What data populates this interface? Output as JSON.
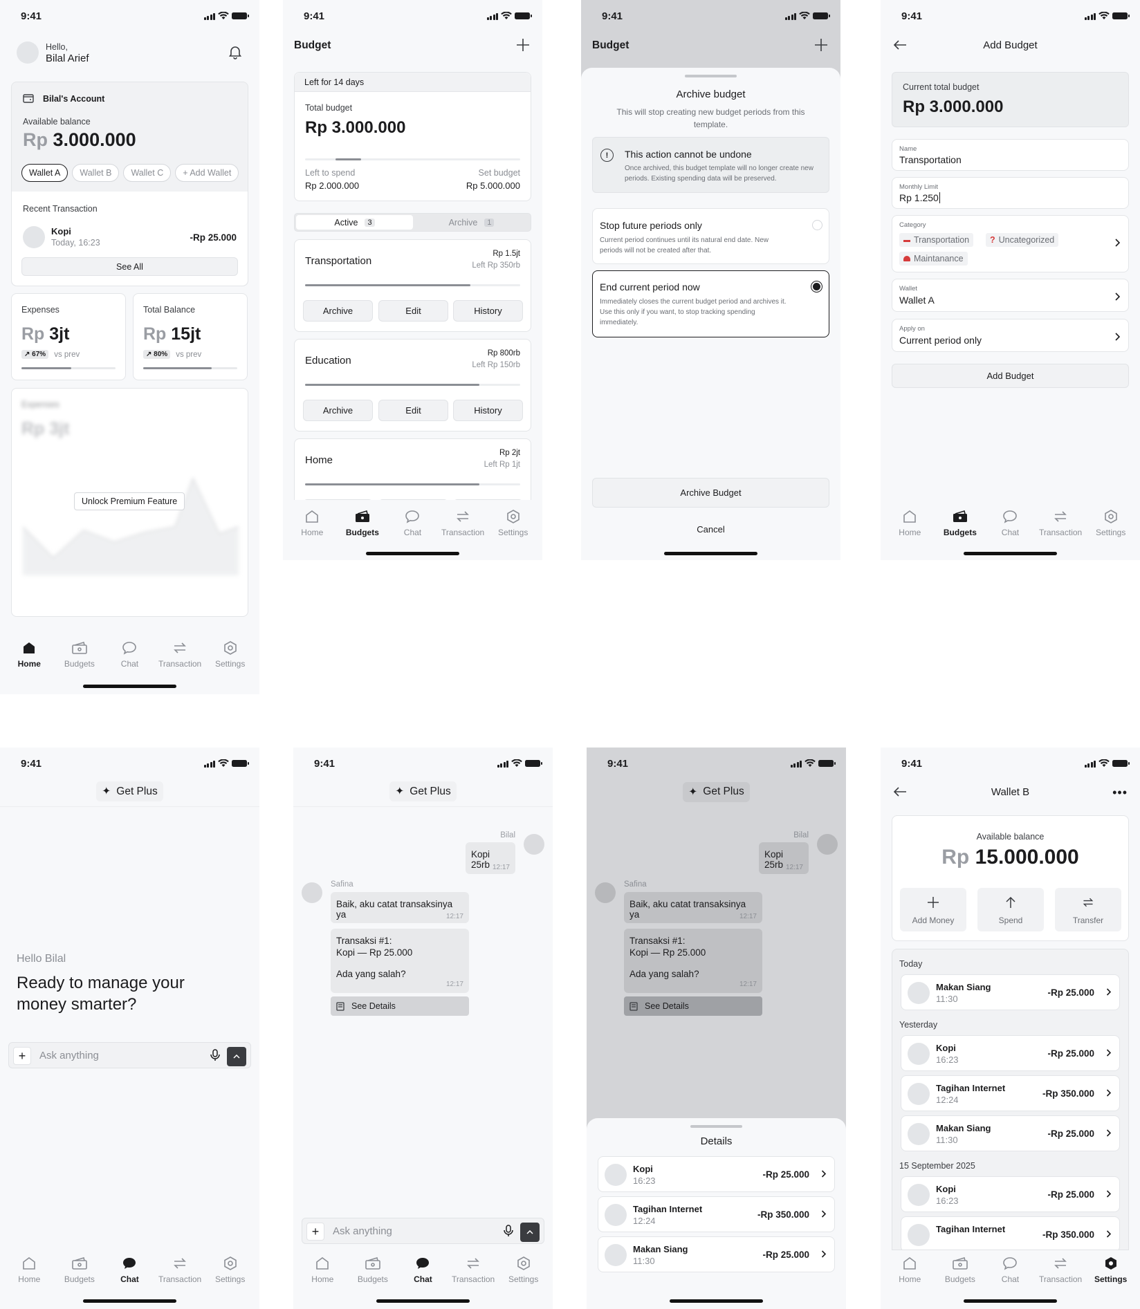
{
  "status_time": "9:41",
  "nav": {
    "home": "Home",
    "budgets": "Budgets",
    "chat": "Chat",
    "transaction": "Transaction",
    "settings": "Settings"
  },
  "home": {
    "greeting": "Hello,",
    "user": "Bilal Arief",
    "account_name": "Bilal's Account",
    "balance_label": "Available balance",
    "balance_prefix": "Rp",
    "balance": "3.000.000",
    "wallets": [
      "Wallet A",
      "Wallet B",
      "Wallet C",
      "+ Add Wallet"
    ],
    "recent_label": "Recent Transaction",
    "recent_name": "Kopi",
    "recent_time": "Today, 16:23",
    "recent_amount": "-Rp 25.000",
    "see_all": "See All",
    "expenses_label": "Expenses",
    "expenses_prefix": "Rp",
    "expenses_value": "3jt",
    "expenses_pct": "67%",
    "vs_prev": "vs prev",
    "total_label": "Total Balance",
    "total_prefix": "Rp",
    "total_value": "15jt",
    "total_pct": "80%",
    "chart_title": "Expenses",
    "chart_prefix": "Rp",
    "chart_value": "3jt",
    "unlock": "Unlock Premium Feature"
  },
  "budget": {
    "title": "Budget",
    "left_days": "Left for 14 days",
    "total_label": "Total budget",
    "total_value": "Rp 3.000.000",
    "left_label": "Left to spend",
    "left_value": "Rp 2.000.000",
    "set_label": "Set budget",
    "set_value": "Rp 5.000.000",
    "tab_active": "Active",
    "tab_active_count": "3",
    "tab_archive": "Archive",
    "tab_archive_count": "1",
    "items": [
      {
        "name": "Transportation",
        "amount": "Rp 1.5jt",
        "left": "Left Rp 350rb",
        "progress": 0.77
      },
      {
        "name": "Education",
        "amount": "Rp 800rb",
        "left": "Left Rp 150rb",
        "progress": 0.81
      },
      {
        "name": "Home",
        "amount": "Rp 2jt",
        "left": "Left Rp 1jt",
        "progress": 0.81
      }
    ],
    "btn_archive": "Archive",
    "btn_edit": "Edit",
    "btn_history": "History"
  },
  "archive": {
    "title": "Archive budget",
    "subtitle": "This will stop creating new budget periods from this template.",
    "warn_title": "This action cannot be undone",
    "warn_text": "Once archived, this budget template will no longer create new periods. Existing spending data will be preserved.",
    "opt1_title": "Stop future periods only",
    "opt1_text": "Current period continues until its natural end date. New periods will not be created after that.",
    "opt2_title": "End current period now",
    "opt2_text": "Immediately closes the current budget period and archives it. Use this only if you want, to stop tracking spending immediately.",
    "confirm": "Archive Budget",
    "cancel": "Cancel"
  },
  "add_budget": {
    "title": "Add Budget",
    "current_label": "Current total budget",
    "current_value": "Rp 3.000.000",
    "name_label": "Name",
    "name_value": "Transportation",
    "limit_label": "Monthly Limit",
    "limit_value": "Rp 1.250",
    "category_label": "Category",
    "categories": [
      "Transportation",
      "Uncategorized",
      "Maintanance"
    ],
    "wallet_label": "Wallet",
    "wallet_value": "Wallet A",
    "apply_label": "Apply on",
    "apply_value": "Current period only",
    "submit": "Add Budget"
  },
  "chat": {
    "get_plus": "Get Plus",
    "hello": "Hello Bilal",
    "headline": "Ready to manage your money smarter?",
    "placeholder": "Ask anything",
    "user_name": "Bilal",
    "user_msg": "Kopi 25rb",
    "msg_time": "12:17",
    "bot_name": "Safina",
    "bot_msg1": "Baik, aku catat transaksinya ya",
    "bot_msg2_l1": "Transaksi #1:",
    "bot_msg2_l2": "Kopi — Rp 25.000",
    "bot_msg2_l3": "Ada yang salah?",
    "see_details": "See Details",
    "details_title": "Details"
  },
  "details": [
    {
      "name": "Kopi",
      "time": "16:23",
      "amount": "-Rp 25.000"
    },
    {
      "name": "Tagihan Internet",
      "time": "12:24",
      "amount": "-Rp 350.000"
    },
    {
      "name": "Makan Siang",
      "time": "11:30",
      "amount": "-Rp 25.000"
    }
  ],
  "wallet_b": {
    "title": "Wallet B",
    "balance_label": "Available balance",
    "prefix": "Rp",
    "balance": "15.000.000",
    "add": "Add Money",
    "spend": "Spend",
    "transfer": "Transfer",
    "today": "Today",
    "yesterday": "Yesterday",
    "date3": "15 September 2025",
    "tx_today": [
      {
        "name": "Makan Siang",
        "time": "11:30",
        "amount": "-Rp 25.000"
      }
    ],
    "tx_yesterday": [
      {
        "name": "Kopi",
        "time": "16:23",
        "amount": "-Rp 25.000"
      },
      {
        "name": "Tagihan Internet",
        "time": "12:24",
        "amount": "-Rp 350.000"
      },
      {
        "name": "Makan Siang",
        "time": "11:30",
        "amount": "-Rp 25.000"
      }
    ],
    "tx_date3": [
      {
        "name": "Kopi",
        "time": "16:23",
        "amount": "-Rp 25.000"
      },
      {
        "name": "Tagihan Internet",
        "time": "",
        "amount": "-Rp 350.000"
      }
    ]
  }
}
